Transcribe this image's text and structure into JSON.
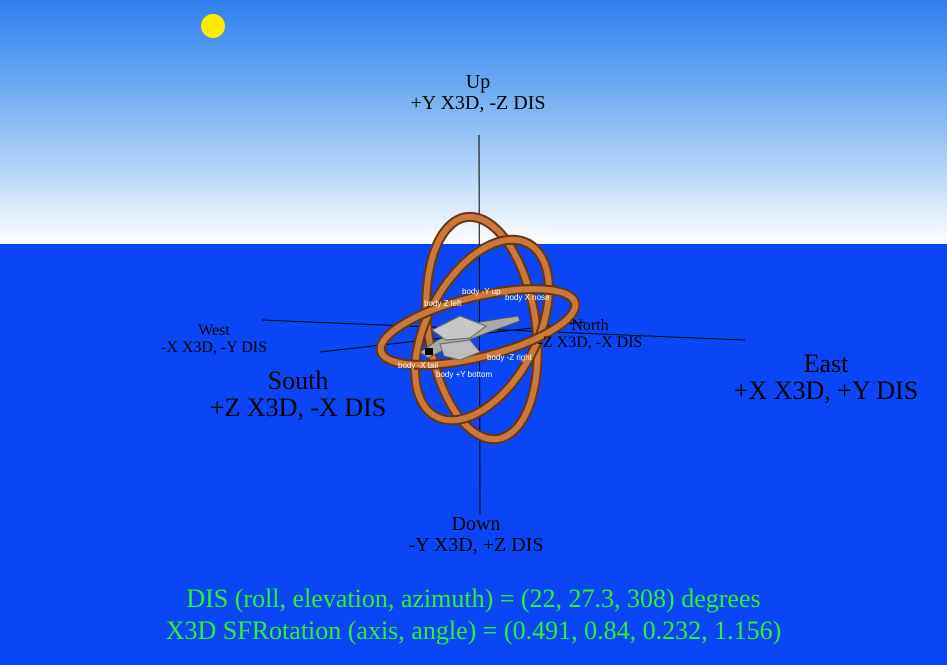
{
  "labels": {
    "up": {
      "title": "Up",
      "sub": "+Y X3D, -Z DIS"
    },
    "down": {
      "title": "Down",
      "sub": "-Y X3D, +Z DIS"
    },
    "west": {
      "title": "West",
      "sub": "-X X3D, -Y DIS"
    },
    "east": {
      "title": "East",
      "sub": "+X X3D, +Y DIS"
    },
    "south": {
      "title": "South",
      "sub": "+Z X3D, -X DIS"
    },
    "north": {
      "title": "North",
      "sub": "-Z X3D, -X DIS"
    }
  },
  "body_axes": {
    "y_up": "body -Y up",
    "z_left": "body Z left",
    "x_nose": "body X nose",
    "x_tail": "body -X tail",
    "z_right": "body -Z right",
    "y_bottom": "body +Y bottom"
  },
  "footer": {
    "dis_line": "DIS (roll, elevation, azimuth) = (22, 27.3, 308) degrees",
    "x3d_line": "X3D SFRotation (axis, angle) = (0.491, 0.84, 0.232, 1.156)"
  },
  "colors": {
    "sky_top": "#2f7ff0",
    "horizon": "#ffffff",
    "sea": "#0a46f5",
    "sun": "#ffea00",
    "ring": "#c96f2a",
    "caption": "#2df02d"
  }
}
